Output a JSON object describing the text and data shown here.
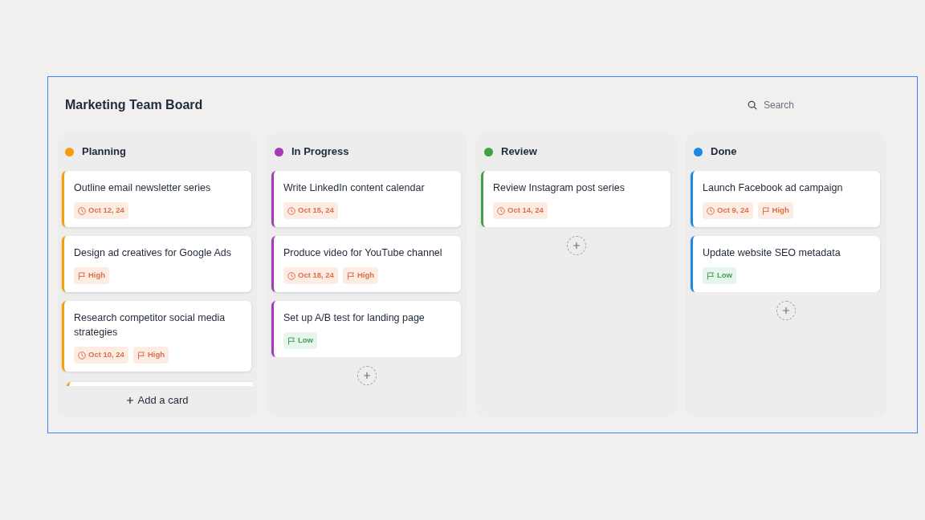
{
  "board": {
    "title": "Marketing Team Board",
    "search": {
      "placeholder": "Search"
    }
  },
  "columns": [
    {
      "name": "Planning",
      "color": "#f59e0b",
      "cards": [
        {
          "title": "Outline email newsletter series",
          "tags": [
            {
              "kind": "date",
              "text": "Oct 12, 24"
            }
          ]
        },
        {
          "title": "Design ad creatives for Google Ads",
          "tags": [
            {
              "kind": "high",
              "text": "High"
            }
          ]
        },
        {
          "title": "Research competitor social media strategies",
          "tags": [
            {
              "kind": "date",
              "text": "Oct 10, 24"
            },
            {
              "kind": "high",
              "text": "High"
            }
          ]
        }
      ],
      "add": {
        "kind": "footer",
        "label": "Add a card"
      }
    },
    {
      "name": "In Progress",
      "color": "#a53bb8",
      "cards": [
        {
          "title": "Write LinkedIn content calendar",
          "tags": [
            {
              "kind": "date",
              "text": "Oct 15, 24"
            }
          ]
        },
        {
          "title": "Produce video for YouTube channel",
          "tags": [
            {
              "kind": "date",
              "text": "Oct 18, 24"
            },
            {
              "kind": "high",
              "text": "High"
            }
          ]
        },
        {
          "title": "Set up A/B test for landing page",
          "tags": [
            {
              "kind": "low",
              "text": "Low"
            }
          ]
        }
      ],
      "add": {
        "kind": "circle"
      }
    },
    {
      "name": "Review",
      "color": "#43a047",
      "cards": [
        {
          "title": "Review Instagram post series",
          "tags": [
            {
              "kind": "date",
              "text": "Oct 14, 24"
            }
          ]
        }
      ],
      "add": {
        "kind": "circle"
      }
    },
    {
      "name": "Done",
      "color": "#1e88e5",
      "cards": [
        {
          "title": "Launch Facebook ad campaign",
          "tags": [
            {
              "kind": "date",
              "text": "Oct 9, 24"
            },
            {
              "kind": "high",
              "text": "High"
            }
          ]
        },
        {
          "title": "Update website SEO metadata",
          "tags": [
            {
              "kind": "low",
              "text": "Low"
            }
          ]
        }
      ],
      "add": {
        "kind": "circle"
      }
    }
  ]
}
